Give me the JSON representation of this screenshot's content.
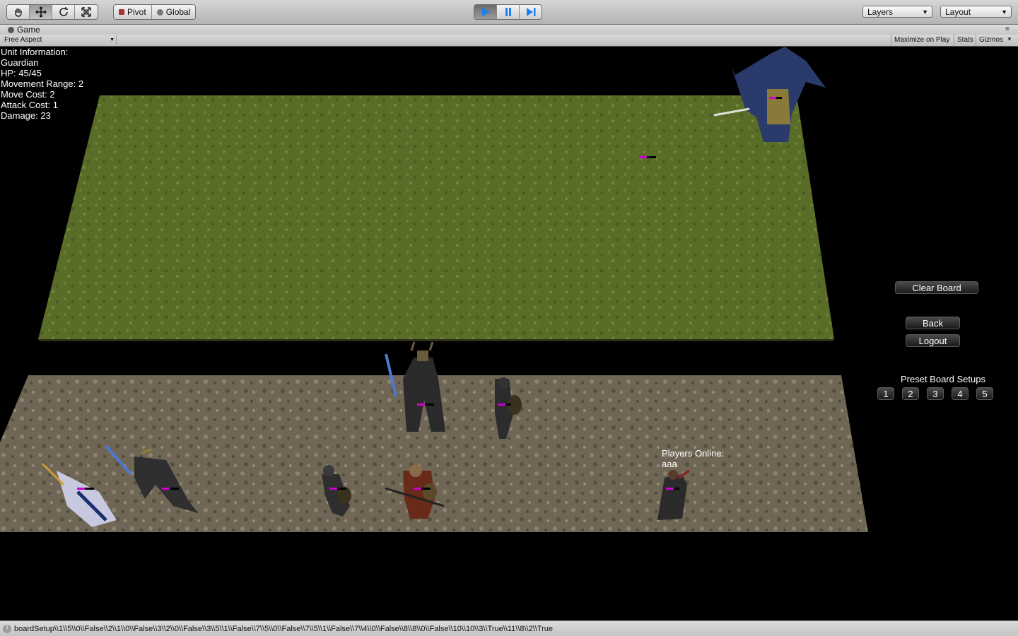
{
  "toolbar": {
    "tools": [
      "hand-tool-icon",
      "move-tool-icon",
      "rotate-tool-icon",
      "scale-tool-icon"
    ],
    "pivot_label": "Pivot",
    "global_label": "Global",
    "layers_label": "Layers",
    "layout_label": "Layout"
  },
  "game_window": {
    "tab_label": "Game",
    "aspect_label": "Free Aspect",
    "maximize_label": "Maximize on Play",
    "stats_label": "Stats",
    "gizmos_label": "Gizmos"
  },
  "unit_info": {
    "header": "Unit Information:",
    "name": "Guardian",
    "hp": "HP: 45/45",
    "movement": "Movement Range: 2",
    "move_cost": "Move Cost: 2",
    "attack_cost": "Attack Cost: 1",
    "damage": "Damage: 23"
  },
  "controls": {
    "clear_board": "Clear Board",
    "back": "Back",
    "logout": "Logout",
    "preset_title": "Preset Board Setups",
    "presets": [
      "1",
      "2",
      "3",
      "4",
      "5"
    ]
  },
  "online": {
    "title": "Players Online:",
    "player": "aaa"
  },
  "colors": {
    "grass": "#5a6d28",
    "rock": "#6f6655",
    "health_bar": "#d000d0"
  },
  "status": {
    "message": "boardSetup\\\\1\\\\5\\\\0\\\\False\\\\2\\\\1\\\\0\\\\False\\\\3\\\\2\\\\0\\\\False\\\\3\\\\5\\\\1\\\\False\\\\7\\\\5\\\\0\\\\False\\\\7\\\\5\\\\1\\\\False\\\\7\\\\4\\\\0\\\\False\\\\8\\\\8\\\\0\\\\False\\\\10\\\\10\\\\3\\\\True\\\\11\\\\8\\\\2\\\\True"
  }
}
